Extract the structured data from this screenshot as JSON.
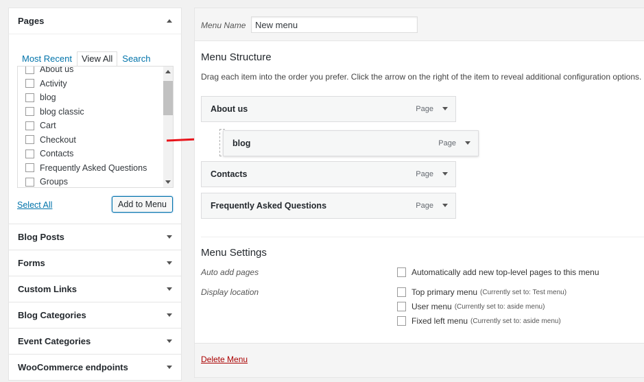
{
  "left": {
    "pages": {
      "title": "Pages",
      "tabs": [
        "Most Recent",
        "View All",
        "Search"
      ],
      "items": [
        "About us",
        "Activity",
        "blog",
        "blog classic",
        "Cart",
        "Checkout",
        "Contacts",
        "Frequently Asked Questions",
        "Groups"
      ],
      "select_all": "Select All",
      "add_button": "Add to Menu"
    },
    "accordions": [
      "Blog Posts",
      "Forms",
      "Custom Links",
      "Blog Categories",
      "Event Categories",
      "WooCommerce endpoints"
    ]
  },
  "menu": {
    "name_label": "Menu Name",
    "name_value": "New menu",
    "structure_title": "Menu Structure",
    "structure_desc": "Drag each item into the order you prefer. Click the arrow on the right of the item to reveal additional configuration options.",
    "items": [
      {
        "label": "About us",
        "type": "Page"
      },
      {
        "label": "blog",
        "type": "Page"
      },
      {
        "label": "Contacts",
        "type": "Page"
      },
      {
        "label": "Frequently Asked Questions",
        "type": "Page"
      }
    ],
    "settings_title": "Menu Settings",
    "auto_add_label": "Auto add pages",
    "auto_add_option": "Automatically add new top-level pages to this menu",
    "display_location_label": "Display location",
    "locations": [
      {
        "label": "Top primary menu",
        "note": "(Currently set to: Test menu)"
      },
      {
        "label": "User menu",
        "note": "(Currently set to: aside menu)"
      },
      {
        "label": "Fixed left menu",
        "note": "(Currently set to: aside menu)"
      }
    ],
    "delete": "Delete Menu"
  },
  "colors": {
    "link": "#0073aa",
    "delete": "#a00",
    "arrow": "#e8141b"
  }
}
